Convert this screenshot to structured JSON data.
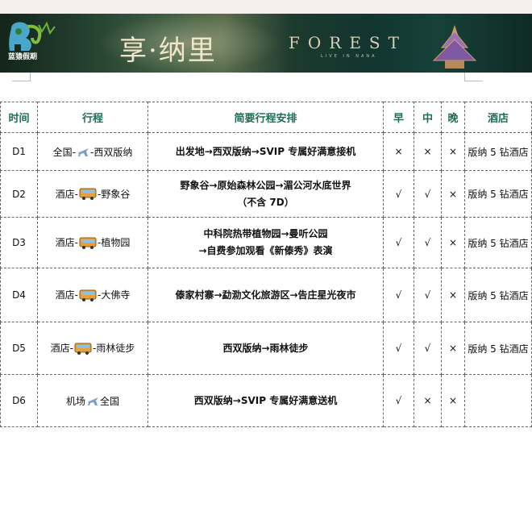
{
  "banner": {
    "logo_text": "蓝猿假期",
    "title": "享·纳里",
    "forest": "FOREST",
    "forest_sub": "LIVE IN NANA"
  },
  "table": {
    "headers": [
      "时间",
      "行程",
      "简要行程安排",
      "早",
      "中",
      "晚",
      "酒店"
    ],
    "rows": [
      {
        "day": "D1",
        "route_from": "全国-",
        "route_icon": "plane-icon",
        "route_to": "-西双版纳",
        "plan": [
          "出发地→西双版纳→SVIP 专属好满意接机"
        ],
        "breakfast": "×",
        "lunch": "×",
        "dinner": "×",
        "hotel": "版纳 5 钻酒店"
      },
      {
        "day": "D2",
        "route_from": "酒店-",
        "route_icon": "bus-icon",
        "route_to": "-野象谷",
        "plan": [
          "野象谷→原始森林公园→湄公河水底世界",
          "（不含 7D）"
        ],
        "breakfast": "√",
        "lunch": "√",
        "dinner": "×",
        "hotel": "版纳 5 钻酒店"
      },
      {
        "day": "D3",
        "route_from": "酒店-",
        "route_icon": "bus-icon",
        "route_to": "-植物园",
        "plan": [
          "中科院热带植物园→曼听公园",
          "→自费参加观看《新傣秀》表演"
        ],
        "breakfast": "√",
        "lunch": "√",
        "dinner": "×",
        "hotel": "版纳 5 钻酒店"
      },
      {
        "day": "D4",
        "route_from": "酒店-",
        "route_icon": "bus-icon",
        "route_to": "-大佛寺",
        "plan": [
          "傣家村寨→勐泐文化旅游区→告庄星光夜市"
        ],
        "breakfast": "√",
        "lunch": "√",
        "dinner": "×",
        "hotel": "版纳 5 钻酒店"
      },
      {
        "day": "D5",
        "route_from": "酒店-",
        "route_icon": "bus-icon",
        "route_to": "-雨林徒步",
        "plan": [
          "西双版纳→雨林徒步"
        ],
        "breakfast": "√",
        "lunch": "√",
        "dinner": "×",
        "hotel": "版纳 5 钻酒店"
      },
      {
        "day": "D6",
        "route_from": "机场",
        "route_icon": "plane-icon",
        "route_to": "全国",
        "plan": [
          "西双版纳→SVIP 专属好满意送机"
        ],
        "breakfast": "√",
        "lunch": "×",
        "dinner": "×",
        "hotel": ""
      }
    ]
  }
}
